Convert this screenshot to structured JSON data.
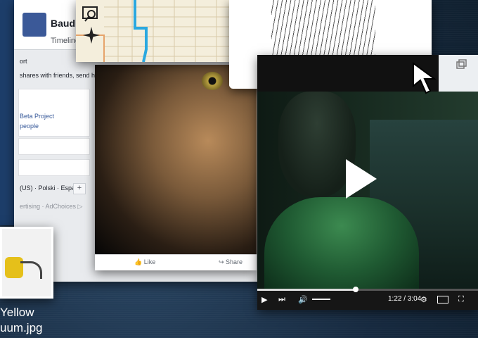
{
  "facebook": {
    "profile_name": "Baudi M",
    "timeline_tab": "Timeline",
    "post_text": "shares with friends, send her a fr",
    "port_label": "ort",
    "beta_project": "Beta Project",
    "people_label": "people",
    "languages": "(US) · Polski · Español",
    "ad_line": "ertising · AdChoices ▷",
    "like_label": "Like",
    "share_label": "Share",
    "plus_label": "+"
  },
  "video": {
    "time_display": "1:22 / 3:04",
    "progress_fraction": 0.446
  },
  "desktop_file": {
    "line1": "Yellow",
    "line2": "uum.jpg"
  },
  "icons": {
    "map_search": "map-search-icon",
    "compass": "compass-icon",
    "popout": "popout-icon",
    "cursor": "mouse-cursor-icon"
  }
}
